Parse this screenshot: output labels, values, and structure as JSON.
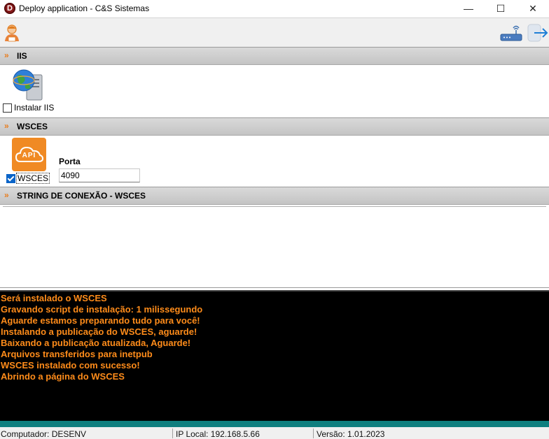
{
  "window": {
    "title": "Deploy application - C&S Sistemas",
    "app_icon_letter": "D",
    "minimize_glyph": "—",
    "maximize_glyph": "☐",
    "close_glyph": "✕"
  },
  "toolbar": {
    "left_icon": "user-support-icon",
    "right_icons": [
      "network-router-icon",
      "exit-arrow-icon"
    ]
  },
  "sections": {
    "iis": {
      "title": "IIS",
      "chevron": "»",
      "checkbox_label": "Instalar IIS",
      "checked": false,
      "icon": "globe-server-icon"
    },
    "wsces": {
      "title": "WSCES",
      "chevron": "»",
      "checkbox_label": "WSCES",
      "checked": true,
      "icon": "api-cloud-icon",
      "api_text": "API",
      "port_label": "Porta",
      "port_value": "4090"
    },
    "string": {
      "title": "STRING DE CONEXÃO - WSCES",
      "chevron": "»"
    }
  },
  "log": {
    "lines": [
      "Será instalado o WSCES",
      "Gravando script de instalação: 1 milissegundo",
      "Aguarde estamos preparando tudo para você!",
      "Instalando a publicação do WSCES, aguarde!",
      "Baixando a publicação atualizada, Aguarde!",
      "Arquivos transferidos para inetpub",
      "WSCES instalado com sucesso!",
      "Abrindo a página do WSCES"
    ],
    "text_color": "#ff8c1a",
    "background": "#000000"
  },
  "status": {
    "computer": "Computador: DESENV",
    "ip": "IP Local: 192.168.5.66",
    "version": "Versão: 1.01.2023"
  },
  "colors": {
    "accent_orange": "#f08a24",
    "checkbox_blue": "#0a64c8",
    "teal_bar": "#0f7f7f"
  }
}
